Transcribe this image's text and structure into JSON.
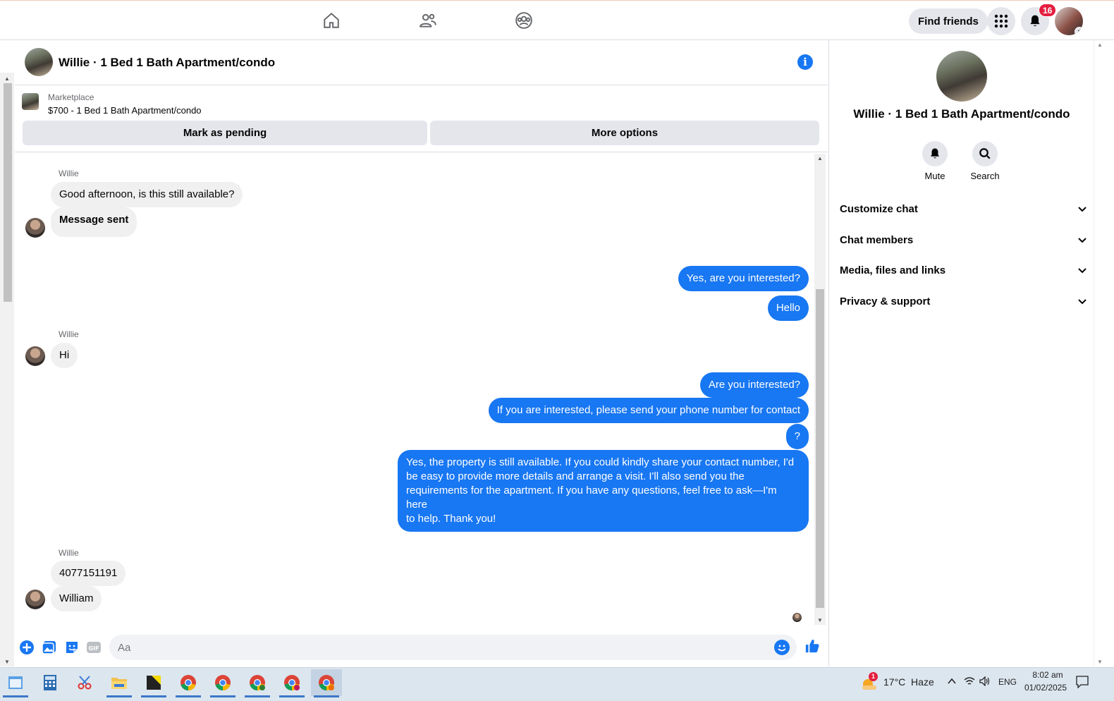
{
  "nav": {
    "find_friends": "Find friends",
    "notification_count": "16"
  },
  "chat": {
    "title": "Willie · 1 Bed 1 Bath Apartment/condo",
    "marketplace_label": "Marketplace",
    "listing": "$700 - 1 Bed 1 Bath Apartment/condo",
    "mark_pending": "Mark as pending",
    "more_options": "More options"
  },
  "messages": {
    "sender": "Willie",
    "m1": "Good afternoon, is this still available?",
    "m2": "Message sent",
    "m3": "Yes, are you interested?",
    "m4": "Hello",
    "m5": "Hi",
    "m6": "Are you interested?",
    "m7": "If you are interested, please send your phone number for contact",
    "m8": "?",
    "m9_line1": "Yes, the property is still available. If you could kindly share your contact number, I'd",
    "m9_line2": "be easy to provide more details and arrange a visit. I'll also send you the",
    "m9_line3": "requirements for the apartment. If you have any questions, feel free to ask—I'm here",
    "m9_line4": "to help. Thank you!",
    "m10": "4077151191",
    "m11": "William"
  },
  "composer": {
    "placeholder": "Aa"
  },
  "panel": {
    "title": "Willie · 1 Bed 1 Bath Apartment/condo",
    "mute": "Mute",
    "search": "Search",
    "items": [
      "Customize chat",
      "Chat members",
      "Media, files and links",
      "Privacy & support"
    ]
  },
  "taskbar": {
    "weather": "17°C  Haze",
    "weather_badge": "1",
    "lang": "ENG",
    "time": "8:02 am",
    "date": "01/02/2025"
  },
  "colors": {
    "accent": "#1877f2",
    "bubble_in": "#f0f0f0",
    "badge": "#e41e3f"
  }
}
